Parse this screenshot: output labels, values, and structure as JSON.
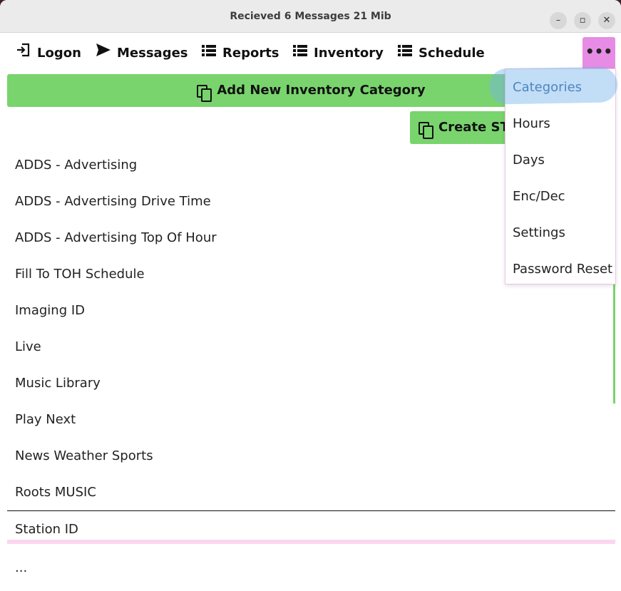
{
  "window": {
    "title": "Recieved 6 Messages  21 Mib",
    "minimize_label": "–",
    "maximize_label": "▫",
    "close_label": "✕"
  },
  "nav": {
    "logon": "Logon",
    "messages": "Messages",
    "reports": "Reports",
    "inventory": "Inventory",
    "schedule": "Schedule",
    "more": "•••"
  },
  "actions": {
    "add_category": "Add New Inventory Category",
    "create_stub": "Create STU"
  },
  "categories": [
    "ADDS - Advertising",
    "ADDS - Advertising Drive Time",
    "ADDS - Advertising Top Of Hour",
    "Fill To TOH Schedule",
    "Imaging ID",
    "Live",
    "Music Library",
    "Play Next",
    "News Weather Sports",
    "Roots MUSIC",
    "Station ID"
  ],
  "more_row": "...",
  "menu": {
    "items": [
      "Categories",
      "Hours",
      "Days",
      "Enc/Dec",
      "Settings",
      "Password Reset"
    ],
    "selected": "Categories"
  },
  "icons": {
    "logon": "login-icon",
    "messages": "send-icon",
    "reports": "list-icon",
    "inventory": "list-icon",
    "schedule": "list-icon",
    "copy": "copy-icon"
  },
  "colors": {
    "accent_green": "#79d46d",
    "menu_button": "#e68ce4",
    "selected_text": "#2a5f9e"
  }
}
